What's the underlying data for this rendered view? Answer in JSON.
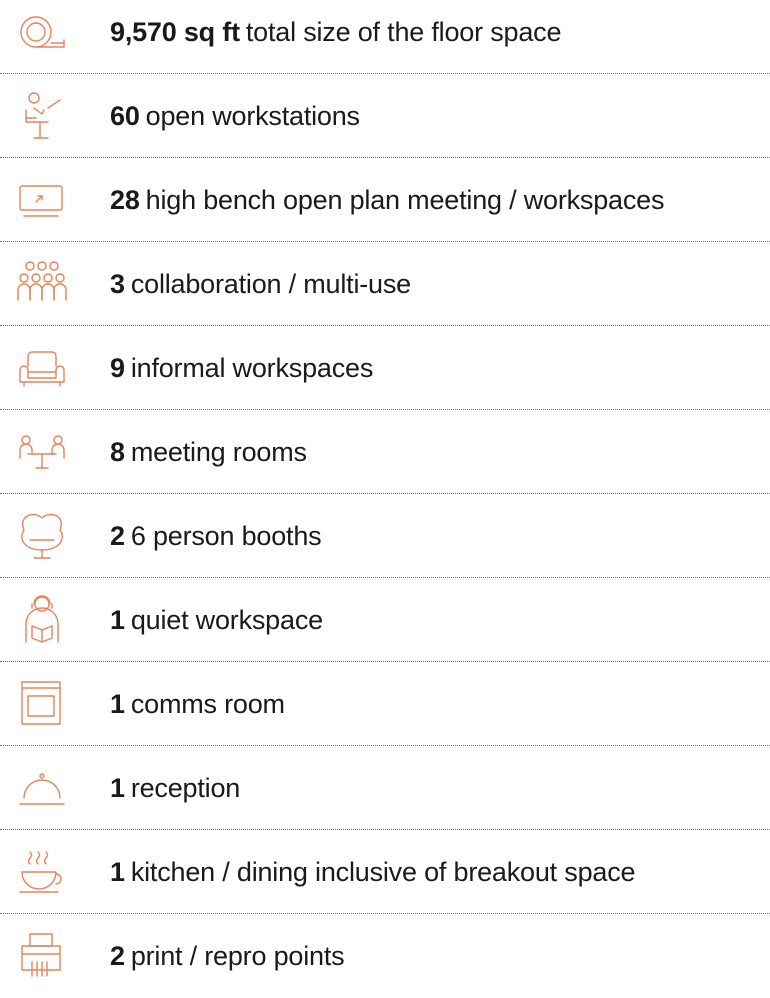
{
  "icon_color": "#e8835a",
  "items": [
    {
      "icon": "tape-measure-icon",
      "number": "9,570 sq ft",
      "text": "total size of the floor space"
    },
    {
      "icon": "person-at-desk-icon",
      "number": "60",
      "text": "open workstations"
    },
    {
      "icon": "screen-monitor-icon",
      "number": "28",
      "text": "high bench open plan meeting / workspaces"
    },
    {
      "icon": "group-people-icon",
      "number": "3",
      "text": "collaboration / multi-use"
    },
    {
      "icon": "armchair-icon",
      "number": "9",
      "text": "informal workspaces"
    },
    {
      "icon": "meeting-table-icon",
      "number": "8",
      "text": "meeting rooms"
    },
    {
      "icon": "pod-chair-icon",
      "number": "2",
      "text": "6 person booths"
    },
    {
      "icon": "person-reading-icon",
      "number": "1",
      "text": "quiet workspace"
    },
    {
      "icon": "server-cabinet-icon",
      "number": "1",
      "text": "comms room"
    },
    {
      "icon": "reception-bell-icon",
      "number": "1",
      "text": "reception"
    },
    {
      "icon": "coffee-cup-icon",
      "number": "1",
      "text": "kitchen / dining inclusive of breakout space"
    },
    {
      "icon": "printer-icon",
      "number": "2",
      "text": "print / repro points"
    }
  ]
}
